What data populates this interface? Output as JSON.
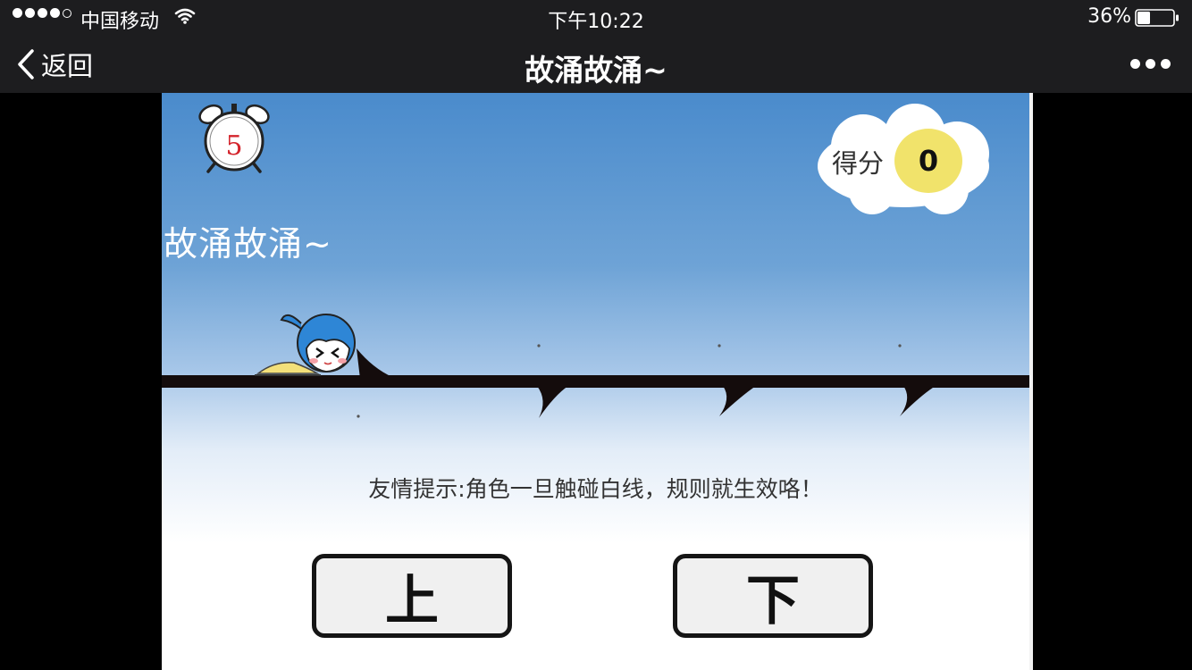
{
  "status_bar": {
    "carrier": "中国移动",
    "time": "下午10:22",
    "battery": "36%",
    "battery_level": 0.36,
    "signal_bars": 4,
    "signal_max": 5
  },
  "nav": {
    "back_label": "返回",
    "title": "故涌故涌~"
  },
  "game": {
    "timer": "5",
    "title": "故涌故涌~",
    "score_label": "得分",
    "score": "0",
    "hint": "友情提示:角色一旦触碰白线，规则就生效咯！",
    "up_label": "上",
    "down_label": "下"
  },
  "colors": {
    "sky_top": "#4a8bcc",
    "score_badge": "#f1e36b",
    "timer_digit": "#d4242c",
    "bar_background": "#1d1d1f"
  }
}
